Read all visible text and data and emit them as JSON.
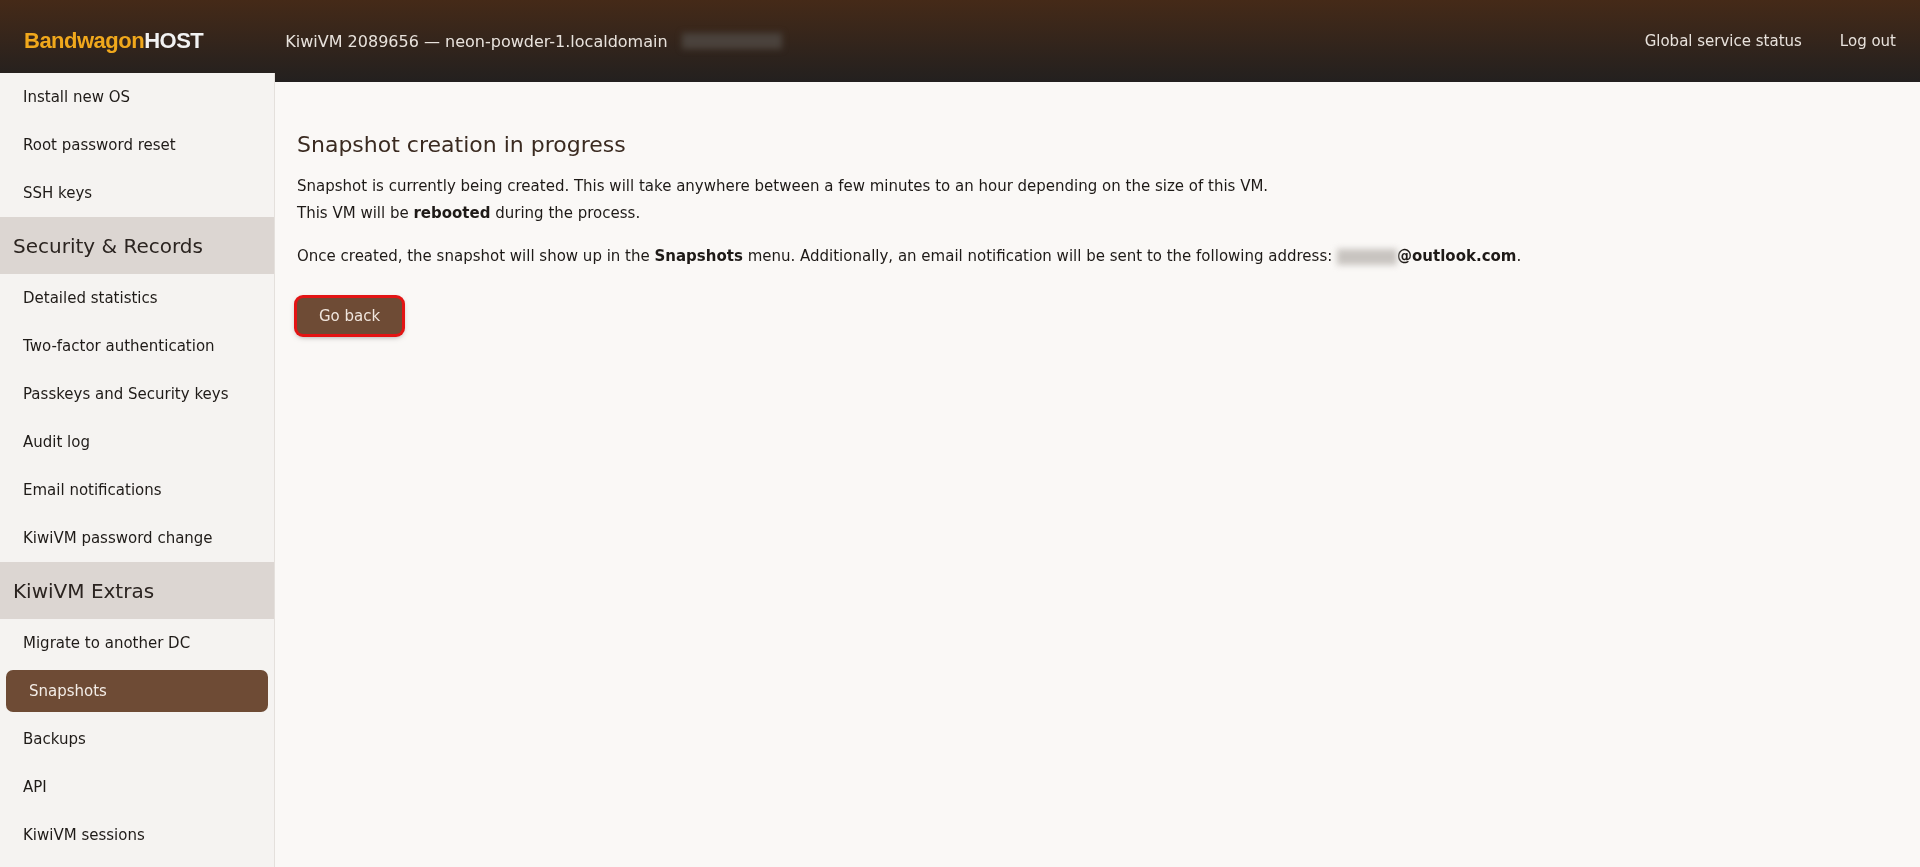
{
  "header": {
    "logo": {
      "part_1": "Bandwagon",
      "part_2": "HOST"
    },
    "vm_title": "KiwiVM 2089656 — neon-powder-1.localdomain",
    "address_masked": true,
    "links": [
      "Global service status",
      "Log out"
    ]
  },
  "sidebar": {
    "groups": [
      {
        "items": [
          {
            "label": "Install new OS",
            "selected": false
          },
          {
            "label": "Root password reset",
            "selected": false
          },
          {
            "label": "SSH keys",
            "selected": false
          }
        ]
      },
      {
        "title": "Security & Records",
        "items": [
          {
            "label": "Detailed statistics",
            "selected": false
          },
          {
            "label": "Two-factor authentication",
            "selected": false
          },
          {
            "label": "Passkeys and Security keys",
            "selected": false
          },
          {
            "label": "Audit log",
            "selected": false
          },
          {
            "label": "Email notifications",
            "selected": false
          },
          {
            "label": "KiwiVM password change",
            "selected": false
          }
        ]
      },
      {
        "title": "KiwiVM Extras",
        "items": [
          {
            "label": "Migrate to another DC",
            "selected": false
          },
          {
            "label": "Snapshots",
            "selected": true
          },
          {
            "label": "Backups",
            "selected": false
          },
          {
            "label": "API",
            "selected": false
          },
          {
            "label": "KiwiVM sessions",
            "selected": false
          }
        ]
      }
    ]
  },
  "content": {
    "title": "Snapshot creation in progress",
    "paragraphs": [
      [
        "Snapshot is currently being created. This will take anywhere between a few minutes to an hour depending on the size of this VM.",
        "This VM will be **rebooted** during the process."
      ]
    ],
    "notice": {
      "before": "Once created, the snapshot will show up in the **Snapshots** menu. Additionally, an email notification will be sent to the following address: ",
      "email_masked": true,
      "after": "**@outlook.com**."
    },
    "button": {
      "label": "Go back",
      "highlighted": true
    }
  }
}
